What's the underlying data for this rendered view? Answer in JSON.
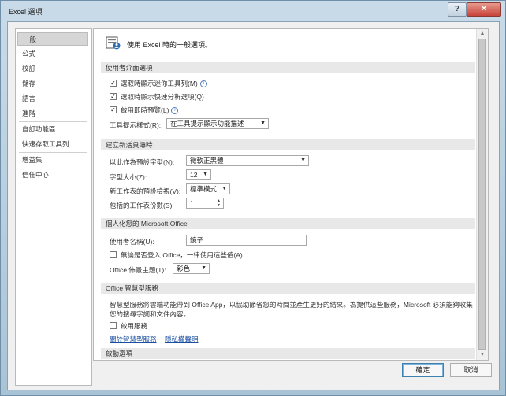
{
  "window": {
    "title": "Excel 選項",
    "help_label": "?",
    "close_label": "✕"
  },
  "nav": {
    "items": [
      {
        "label": "一般",
        "active": true
      },
      {
        "label": "公式"
      },
      {
        "label": "校訂"
      },
      {
        "label": "儲存"
      },
      {
        "label": "語言"
      },
      {
        "label": "進階"
      },
      {
        "label": "自訂功能區"
      },
      {
        "label": "快速存取工具列"
      },
      {
        "label": "增益集"
      },
      {
        "label": "信任中心"
      }
    ]
  },
  "content": {
    "header_text": "使用 Excel 時的一般選項。",
    "ui_section": {
      "title": "使用者介面選項",
      "opt_mini_toolbar": "選取時顯示迷你工具列(M)",
      "opt_quick_analysis": "選取時顯示快速分析選項(Q)",
      "opt_live_preview": "啟用即時預覽(L)",
      "tooltip_label": "工具提示樣式(R):",
      "tooltip_value": "在工具提示顯示功能描述"
    },
    "new_workbook_section": {
      "title": "建立新活頁簿時",
      "font_label": "以此作為預設字型(N):",
      "font_value": "微軟正黑體",
      "size_label": "字型大小(Z):",
      "size_value": "12",
      "view_label": "新工作表的預設檢視(V):",
      "view_value": "標準模式",
      "sheets_label": "包括的工作表份數(S):",
      "sheets_value": "1"
    },
    "personalize_section": {
      "title": "個人化您的 Microsoft Office",
      "username_label": "使用者名稱(U):",
      "username_value": "鏡子",
      "always_use_label": "無論是否登入 Office，一律使用這些值(A)",
      "theme_label": "Office 佈景主題(T):",
      "theme_value": "彩色"
    },
    "intelligent_section": {
      "title": "Office 智慧型服務",
      "description_line1": "智慧型服務將雲端功能帶到 Office App，以協助節省您的時間並產生更好的結果。為提供這些服務，Microsoft 必須能夠收集",
      "description_line2": "您的搜尋字詞和文件內容。",
      "enable_label": "啟用服務",
      "link_about": "關於智慧型服務",
      "link_privacy": "隱私權聲明"
    },
    "startup_section": {
      "title": "啟動選項"
    }
  },
  "footer": {
    "ok_label": "確定",
    "cancel_label": "取消"
  }
}
